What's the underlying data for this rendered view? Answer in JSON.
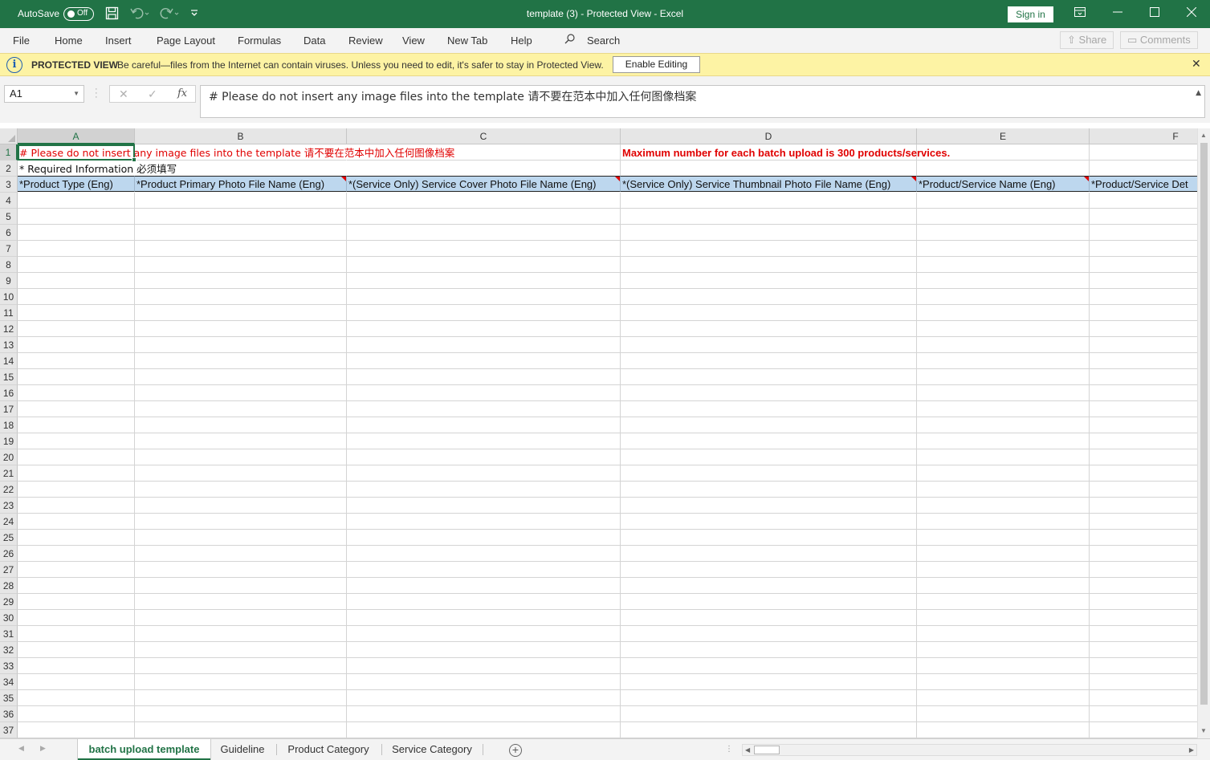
{
  "titlebar": {
    "autosave_label": "AutoSave",
    "autosave_state": "Off",
    "doc_title": "template (3)  -  Protected View  -  Excel",
    "signin_label": "Sign in"
  },
  "menu": {
    "items": [
      "File",
      "Home",
      "Insert",
      "Page Layout",
      "Formulas",
      "Data",
      "Review",
      "View",
      "New Tab",
      "Help"
    ],
    "search_label": "Search",
    "share_label": "Share",
    "comments_label": "Comments"
  },
  "protected_view": {
    "title": "PROTECTED VIEW",
    "message": "Be careful—files from the Internet can contain viruses. Unless you need to edit, it's safer to stay in Protected View.",
    "enable_label": "Enable Editing"
  },
  "formula_bar": {
    "name_box": "A1",
    "fx_label": "fx",
    "content": "# Please do not insert any image files into the template 请不要在范本中加入任何图像档案"
  },
  "sheet": {
    "columns": [
      "A",
      "B",
      "C",
      "D",
      "E",
      "F"
    ],
    "row_numbers": [
      "1",
      "2",
      "3",
      "4",
      "5",
      "6",
      "7",
      "8",
      "9",
      "10",
      "11",
      "12",
      "13",
      "14",
      "15",
      "16",
      "17",
      "18",
      "19",
      "20",
      "21",
      "22",
      "23",
      "24",
      "25",
      "26",
      "27",
      "28",
      "29",
      "30",
      "31",
      "32",
      "33",
      "34",
      "35",
      "36",
      "37"
    ],
    "row1_a": "# Please do not insert any image files into the template 请不要在范本中加入任何图像档案",
    "row1_d": "Maximum number for each batch upload is 300 products/services.",
    "row2_a": "* Required Information 必须填写",
    "headers": [
      "*Product Type (Eng)",
      "*Product Primary Photo File Name (Eng)",
      "*(Service Only) Service Cover Photo File Name (Eng)",
      "*(Service Only) Service Thumbnail Photo File Name (Eng)",
      "*Product/Service Name (Eng)",
      "*Product/Service Det"
    ]
  },
  "tabs": {
    "items": [
      "batch upload template",
      "Guideline",
      "Product Category",
      "Service Category"
    ],
    "active": "batch upload template"
  },
  "colors": {
    "excel_green": "#217346",
    "header_fill": "#bdd7ee",
    "warning_red": "#e00000",
    "protected_view_bg": "#fdf3a4"
  }
}
